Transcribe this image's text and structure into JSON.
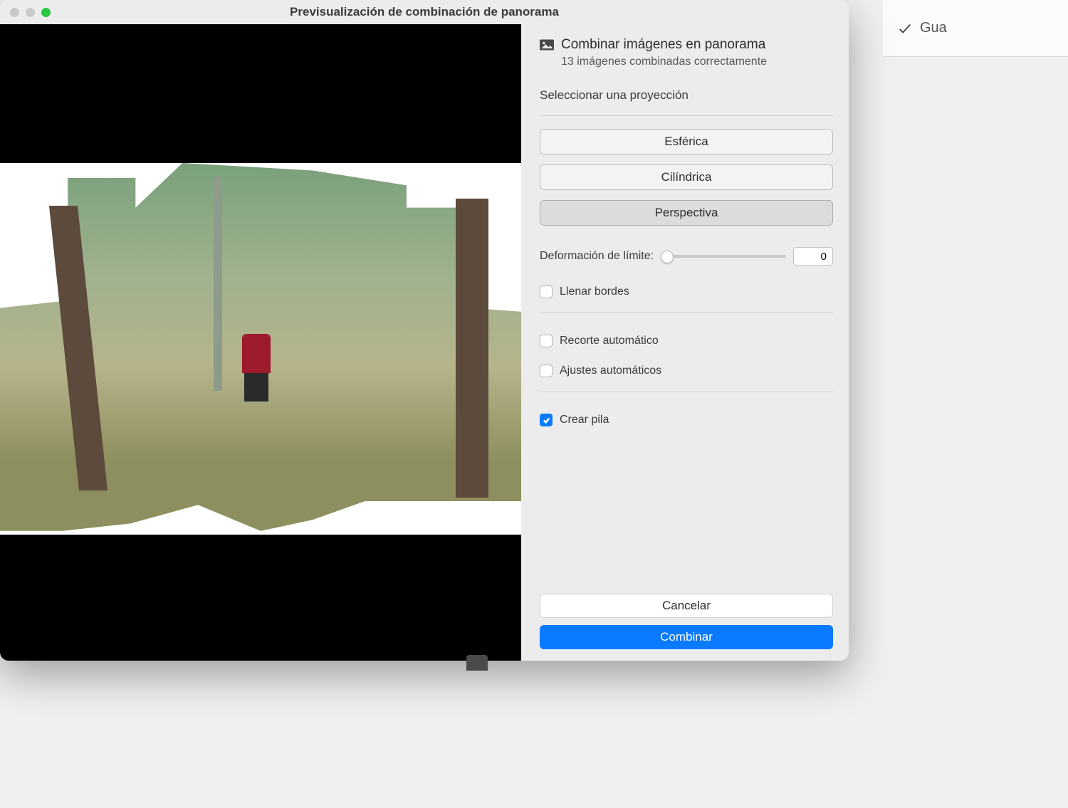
{
  "background": {
    "save_label": "Gua"
  },
  "window": {
    "title": "Previsualización de combinación de panorama"
  },
  "header": {
    "title": "Combinar imágenes en panorama",
    "subtitle": "13 imágenes combinadas correctamente"
  },
  "section": {
    "projection_label": "Seleccionar una proyección"
  },
  "projections": {
    "spherical": "Esférica",
    "cylindrical": "Cilíndrica",
    "perspective": "Perspectiva",
    "selected": "perspective"
  },
  "boundary_warp": {
    "label": "Deformación de límite:",
    "value": 0
  },
  "options": {
    "fill_edges": {
      "label": "Llenar bordes",
      "checked": false
    },
    "auto_crop": {
      "label": "Recorte automático",
      "checked": false
    },
    "auto_settings": {
      "label": "Ajustes automáticos",
      "checked": false
    },
    "create_stack": {
      "label": "Crear pila",
      "checked": true
    }
  },
  "footer": {
    "cancel": "Cancelar",
    "merge": "Combinar"
  }
}
